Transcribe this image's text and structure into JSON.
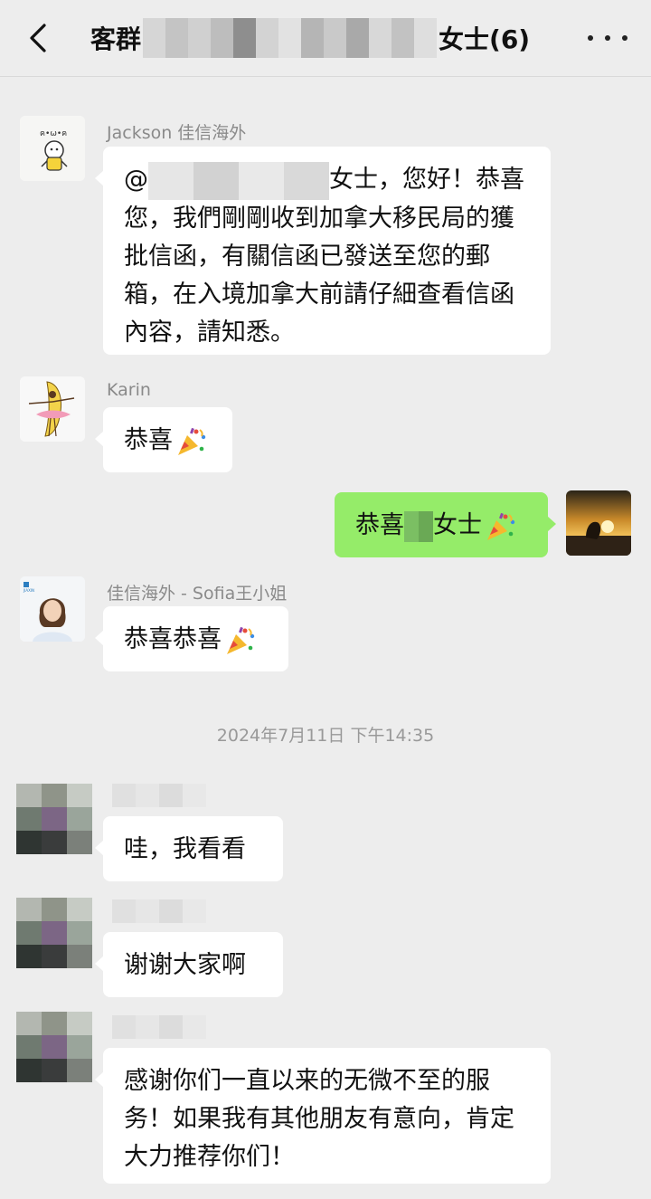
{
  "header": {
    "title_prefix": "客群",
    "title_suffix": "女士(6)"
  },
  "messages": [
    {
      "sender": "Jackson 佳信海外",
      "text_at": "@",
      "text_after": "女士，您好！恭喜您，我們剛剛收到加拿大移民局的獲批信函，有關信函已發送至您的郵箱，在入境加拿大前請仔細查看信函內容，請知悉。"
    },
    {
      "sender": "Karin",
      "text": "恭喜"
    },
    {
      "self": true,
      "text_a": "恭喜",
      "text_b": "女士"
    },
    {
      "sender": "佳信海外 - Sofia王小姐",
      "text": "恭喜恭喜"
    }
  ],
  "timestamp": "2024年7月11日 下午14:35",
  "later_messages": [
    {
      "text": "哇，我看看"
    },
    {
      "text": "谢谢大家啊"
    },
    {
      "text": "感谢你们一直以来的无微不至的服务！如果我有其他朋友有意向，肯定大力推荐你们！"
    }
  ],
  "colors": {
    "background": "#ededed",
    "bubble_self": "#95ec69",
    "bubble_other": "#ffffff"
  },
  "icons": [
    "back-arrow-icon",
    "more-options-icon",
    "party-popper-icon"
  ]
}
